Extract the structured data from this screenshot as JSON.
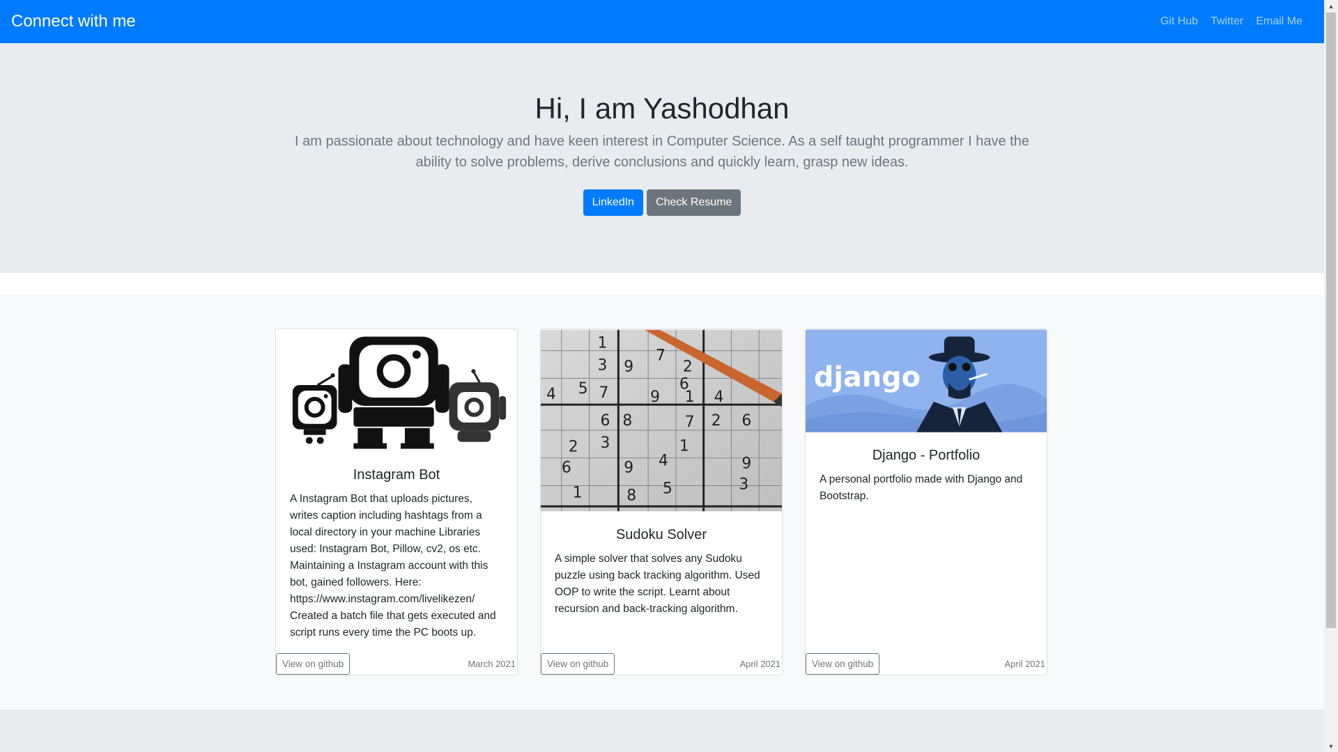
{
  "navbar": {
    "brand": "Connect with me",
    "links": [
      "Git Hub",
      "Twitter",
      "Email Me"
    ]
  },
  "hero": {
    "title": "Hi, I am Yashodhan",
    "lead": "I am passionate about technology and have keen interest in Computer Science. As a self taught programmer I have the ability to solve problems, derive conclusions and quickly learn, grasp new ideas.",
    "buttons": [
      "LinkedIn",
      "Check Resume"
    ]
  },
  "cards": [
    {
      "title": "Instagram Bot",
      "text": "A Instagram Bot that uploads pictures, writes caption including hashtags from a local directory in your machine Libraries used: Instagram Bot, Pillow, cv2, os etc. Maintaining a Instagram account with this bot, gained followers. Here: https://www.instagram.com/livelikezen/ Created a batch file that gets executed and script runs every time the PC boots up.",
      "button": "View on github",
      "date": "March 2021",
      "image": "instagram-robots-icon"
    },
    {
      "title": "Sudoku Solver",
      "text": "A simple solver that solves any Sudoku puzzle using back tracking algorithm. Used OOP to write the script. Learnt about recursion and back-tracking algorithm.",
      "button": "View on github",
      "date": "April 2021",
      "image": "sudoku-grid-pencil",
      "sudoku_digits": [
        "1",
        "3",
        "9",
        "7",
        "6",
        "2",
        "4",
        "5",
        "6",
        "7",
        "8",
        "9",
        "1",
        "4",
        "3",
        "1",
        "7",
        "2",
        "6",
        "2",
        "6",
        "9",
        "4",
        "9",
        "1",
        "8",
        "5",
        "3"
      ]
    },
    {
      "title": "Django - Portfolio",
      "text": "A personal portfolio made with Django and Bootstrap.",
      "button": "View on github",
      "date": "April 2021",
      "image": "django-banner",
      "image_text": "django"
    }
  ],
  "colors": {
    "primary": "#007bff",
    "secondary": "#6c757d",
    "jumbotron": "#e9ecef",
    "album": "#f8f9fa"
  }
}
